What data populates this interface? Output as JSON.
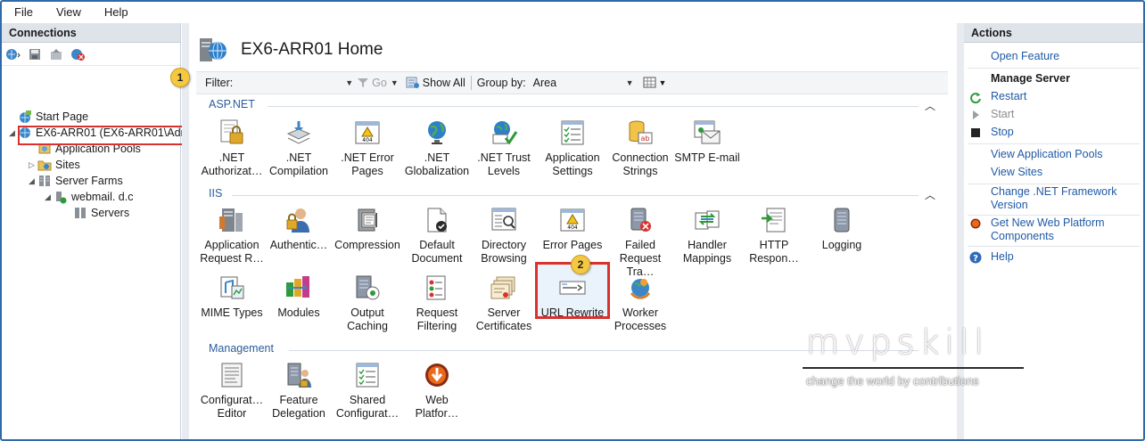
{
  "menu": [
    "File",
    "View",
    "Help"
  ],
  "connections": {
    "title": "Connections",
    "tree": [
      {
        "label": "Start Page"
      },
      {
        "label": "EX6-ARR01 (EX6-ARR01\\Adm"
      },
      {
        "label": "Application Pools"
      },
      {
        "label": "Sites"
      },
      {
        "label": "Server Farms"
      },
      {
        "label": "webmail.                  d.c"
      },
      {
        "label": "Servers"
      }
    ]
  },
  "main": {
    "title": "EX6-ARR01 Home",
    "filter_label": "Filter:",
    "go_label": "Go",
    "show_all_label": "Show All",
    "group_by_label": "Group by:",
    "group_by_value": "Area",
    "groups": [
      {
        "name": "ASP.NET",
        "features": [
          {
            "label": ".NET\nAuthorizat…"
          },
          {
            "label": ".NET\nCompilation"
          },
          {
            "label": ".NET Error\nPages"
          },
          {
            "label": ".NET\nGlobalization"
          },
          {
            "label": ".NET Trust\nLevels"
          },
          {
            "label": "Application\nSettings"
          },
          {
            "label": "Connection\nStrings"
          },
          {
            "label": "SMTP E-mail"
          }
        ]
      },
      {
        "name": "IIS",
        "features": [
          {
            "label": "Application\nRequest R…"
          },
          {
            "label": "Authentic…"
          },
          {
            "label": "Compression"
          },
          {
            "label": "Default\nDocument"
          },
          {
            "label": "Directory\nBrowsing"
          },
          {
            "label": "Error Pages"
          },
          {
            "label": "Failed\nRequest Tra…"
          },
          {
            "label": "Handler\nMappings"
          },
          {
            "label": "HTTP\nRespon…"
          },
          {
            "label": "Logging"
          },
          {
            "label": "MIME Types"
          },
          {
            "label": "Modules"
          },
          {
            "label": "Output\nCaching"
          },
          {
            "label": "Request\nFiltering"
          },
          {
            "label": "Server\nCertificates"
          },
          {
            "label": "URL Rewrite"
          },
          {
            "label": "Worker\nProcesses"
          }
        ]
      },
      {
        "name": "Management",
        "features": [
          {
            "label": "Configurat…\nEditor"
          },
          {
            "label": "Feature\nDelegation"
          },
          {
            "label": "Shared\nConfigurat…"
          },
          {
            "label": "Web\nPlatfor…"
          }
        ]
      }
    ],
    "badges": [
      "1",
      "2"
    ]
  },
  "actions": {
    "title": "Actions",
    "items": [
      {
        "label": "Open Feature"
      },
      {
        "label": "Manage Server"
      },
      {
        "label": "Restart"
      },
      {
        "label": "Start"
      },
      {
        "label": "Stop"
      },
      {
        "label": "View Application Pools"
      },
      {
        "label": "View Sites"
      },
      {
        "label": "Change .NET Framework Version"
      },
      {
        "label": "Get New Web Platform Components"
      },
      {
        "label": "Help"
      }
    ]
  },
  "watermark": {
    "title": "mvpskill",
    "tagline": "change the world by contributions"
  },
  "colors": {
    "accent": "#1f5aa6",
    "highlight_box": "#d9322e",
    "badge": "#f5c842",
    "group_header": "#2b5c9a"
  }
}
